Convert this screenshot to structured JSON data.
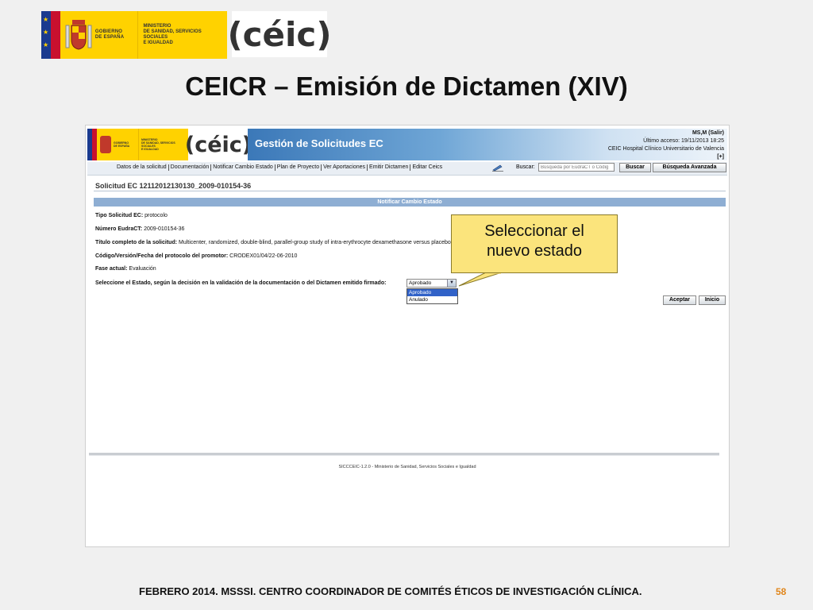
{
  "slide": {
    "logos": {
      "gov_text_1": "GOBIERNO",
      "gov_text_2": "DE ESPAÑA",
      "ministry_line_1": "MINISTERIO",
      "ministry_line_2": "DE SANIDAD, SERVICIOS SOCIALES",
      "ministry_line_3": "E IGUALDAD",
      "ceic_logo": "céic"
    },
    "title": "CEICR – Emisión de Dictamen (XIV)",
    "footer": "FEBRERO 2014. MSSSI. CENTRO COORDINADOR DE COMITÉS ÉTICOS DE INVESTIGACIÓN CLÍNICA.",
    "page_number": "58",
    "callout": {
      "line1": "Seleccionar el",
      "line2": "nuevo estado"
    }
  },
  "app": {
    "title": "Gestión de Solicitudes EC",
    "user": "MS,M (Salir)",
    "last_access": "Último acceso: 19/11/2013 18:25",
    "organization": "CEIC Hospital Clínico Universitario de Valencia",
    "expand": "[+]",
    "nav": [
      "Datos de la solicitud",
      "Documentación",
      "Notificar Cambio Estado",
      "Plan de Proyecto",
      "Ver Aportaciones",
      "Emitir Dictamen",
      "Editar Ceics"
    ],
    "search": {
      "label": "Buscar:",
      "placeholder": "Búsqueda por EudraCT o Códig",
      "button": "Buscar",
      "advanced_button": "Búsqueda Avanzada"
    },
    "solicitud_title": "Solicitud EC 12112012130130_2009-010154-36",
    "section_title": "Notificar Cambio Estado",
    "fields": {
      "tipo_label": "Tipo Solicitud EC:",
      "tipo_value": " protocolo",
      "eudract_label": "Número EudraCT:",
      "eudract_value": " 2009-010154-36",
      "titulo_label": "Título completo de la solicitud:",
      "titulo_value": " Multicenter, randomized, double-blind, parallel-group study of intra-erythrocyte dexamethasone versus placebo in patients with steroid-dependent Crohn's disease.",
      "codigo_label": "Código/Versión/Fecha del protocolo del promotor:",
      "codigo_value": " CRODEX01/04/22-06-2010",
      "fase_label": "Fase actual:",
      "fase_value": " Evaluación",
      "estado_label": "Seleccione el Estado, según la decisión en la validación de la documentación o del Dictamen emitido firmado:"
    },
    "select": {
      "value": "Aprobado",
      "options": [
        "Aprobado",
        "Anulado"
      ]
    },
    "buttons": {
      "accept": "Aceptar",
      "start": "Inicio"
    },
    "footer": "SICCCEIC-1.2.0 - Ministerio de Sanidad, Servicios Sociales e Igualdad"
  },
  "colors": {
    "header_blue": "#3b78b8",
    "section_bar": "#8eaed3",
    "gov_yellow": "#ffd200",
    "callout_yellow": "#fbe47c",
    "page_number_orange": "#e0861c"
  }
}
